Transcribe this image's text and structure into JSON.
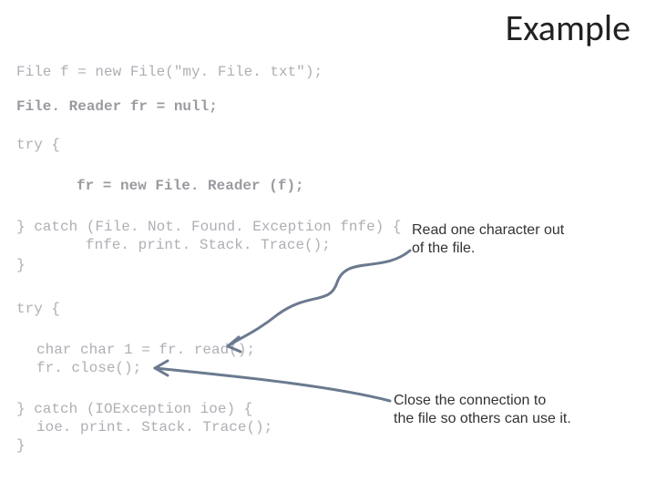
{
  "title": "Example",
  "code": {
    "line1": "File f = new File(\"my. File. txt\");",
    "line2": "File. Reader fr = null;",
    "line3": "try {",
    "line4": "fr = new File. Reader (f);",
    "line5": "} catch (File. Not. Found. Exception fnfe) {",
    "line6": "fnfe. print. Stack. Trace();",
    "line7": "}",
    "line8": "try {",
    "line9": "char char 1 = fr. read();",
    "line10": "fr. close();",
    "line11": "} catch (IOException ioe) {",
    "line12": "ioe. print. Stack. Trace();",
    "line13": "}"
  },
  "annotations": {
    "top": "Read one character out\nof the file.",
    "bottom": "Close the connection to\nthe file so others can use it."
  }
}
